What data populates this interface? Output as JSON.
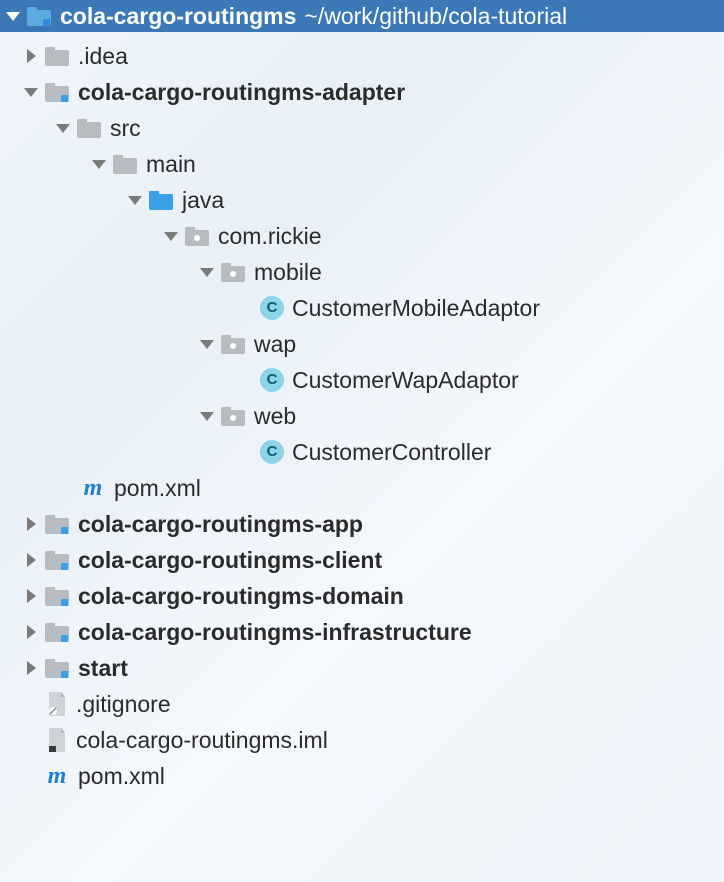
{
  "header": {
    "project_name": "cola-cargo-routingms",
    "project_path": "~/work/github/cola-tutorial"
  },
  "tree": {
    "idea": ".idea",
    "adapter": {
      "name": "cola-cargo-routingms-adapter",
      "src": "src",
      "main": "main",
      "java": "java",
      "pkg": "com.rickie",
      "mobile": "mobile",
      "mobile_class": "CustomerMobileAdaptor",
      "wap": "wap",
      "wap_class": "CustomerWapAdaptor",
      "web": "web",
      "web_class": "CustomerController",
      "pom": "pom.xml"
    },
    "app": "cola-cargo-routingms-app",
    "client": "cola-cargo-routingms-client",
    "domain": "cola-cargo-routingms-domain",
    "infrastructure": "cola-cargo-routingms-infrastructure",
    "start": "start",
    "gitignore": ".gitignore",
    "iml": "cola-cargo-routingms.iml",
    "root_pom": "pom.xml"
  },
  "indent": {
    "l0": 22,
    "l1": 54,
    "l2": 90,
    "l3": 126,
    "l4": 162,
    "l5": 198,
    "l6": 234,
    "l7": 272
  }
}
